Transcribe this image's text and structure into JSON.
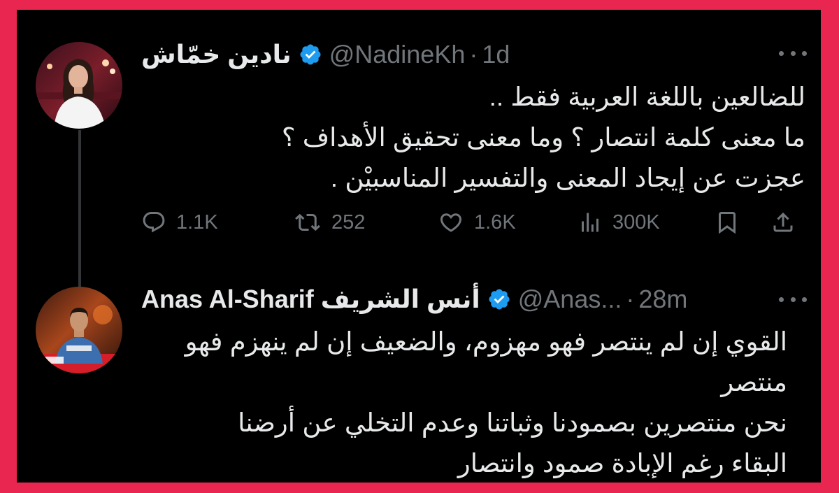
{
  "colors": {
    "border": "#e8264f",
    "background": "#000000",
    "text": "#e7e9ea",
    "muted": "#71767b",
    "verified": "#1d9bf0",
    "thread_line": "#333639"
  },
  "tweets": [
    {
      "display_name": "نادين خمّاش",
      "handle": "@NadineKh",
      "separator": "·",
      "time": "1d",
      "verified_icon": "verified-badge-icon",
      "more_icon": "more-options-icon",
      "text_lines": [
        "للضالعين باللغة العربية فقط ..",
        "ما معنى كلمة انتصار ؟ وما معنى تحقيق الأهداف ؟",
        "عجزت عن إيجاد المعنى والتفسير المناسبيْن ."
      ],
      "actions": {
        "replies": "1.1K",
        "retweets": "252",
        "likes": "1.6K",
        "views": "300K",
        "reply_icon": "reply-icon",
        "retweet_icon": "retweet-icon",
        "like_icon": "heart-icon",
        "views_icon": "views-chart-icon",
        "bookmark_icon": "bookmark-icon",
        "share_icon": "share-icon"
      }
    },
    {
      "display_name": "Anas Al-Sharif أنس الشريف",
      "handle": "@Anas...",
      "separator": "·",
      "time": "28m",
      "verified_icon": "verified-badge-icon",
      "more_icon": "more-options-icon",
      "text_lines": [
        "القوي إن لم ينتصر فهو مهزوم، والضعيف إن لم ينهزم فهو",
        "منتصر",
        "نحن منتصرين بصمودنا وثباتنا وعدم التخلي عن أرضنا",
        "البقاء رغم الإبادة صمود وانتصار"
      ]
    }
  ]
}
